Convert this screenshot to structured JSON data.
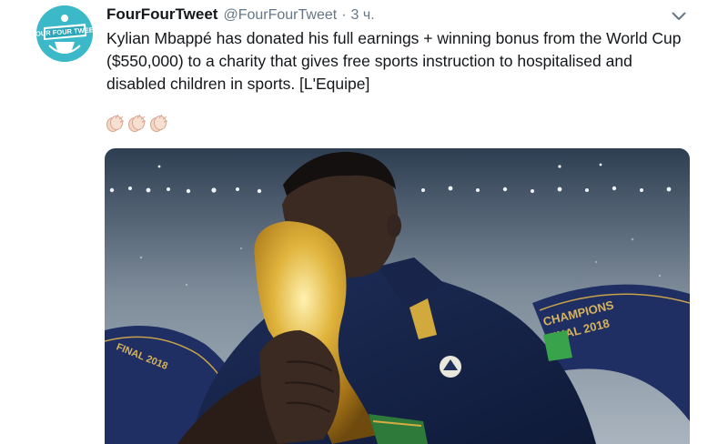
{
  "tweet": {
    "author": {
      "display_name": "FourFourTweet",
      "handle": "@FourFourTweet",
      "avatar_text": "FOUR FOUR TWEET"
    },
    "separator": "·",
    "timestamp": "3 ч.",
    "text": "Kylian Mbappé has donated his full earnings + winning bonus from the World Cup ($550,000) to a charity that gives free sports instruction to hospitalised and disabled children in sports. [L'Equipe]",
    "emojis": [
      "clapping-hands",
      "clapping-hands",
      "clapping-hands"
    ],
    "media": {
      "banner_text_top": "CHAMPIONS",
      "banner_text_bottom": "FINAL 2018",
      "banner_text_left": "FINAL 2018"
    },
    "menu_icon": "chevron-down-icon"
  }
}
